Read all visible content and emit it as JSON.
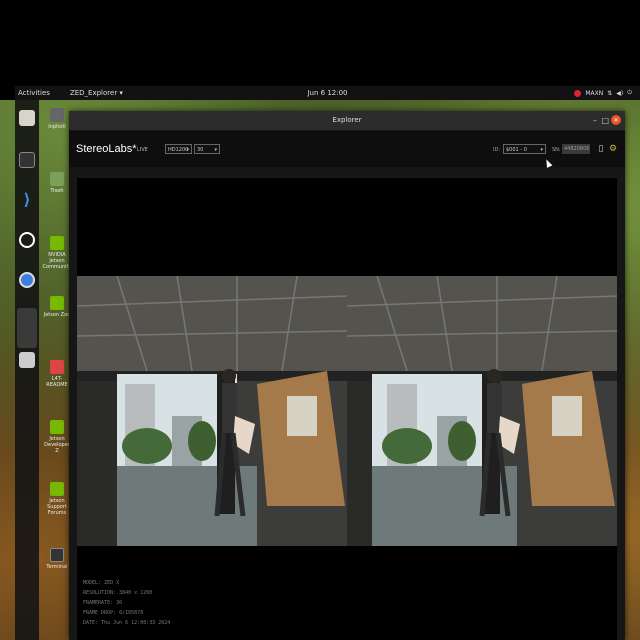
{
  "topbar": {
    "activities": "Activities",
    "app_menu": "ZED_Explorer ▾",
    "clock": "Jun 6 12:00",
    "tray_label": "MAXN"
  },
  "desktop": {
    "icons": [
      "Inphoti",
      "Trash",
      "NVIDIA Jetson Community",
      "Jetson Zoo",
      "L4T-README",
      "Jetson Developer Z",
      "Jetson Support Forums",
      "Terminal"
    ]
  },
  "window": {
    "title": "Explorer",
    "minimize": "–",
    "maximize": "□",
    "close": "×"
  },
  "toolbar": {
    "brand": "StereoLabs*",
    "live_label": "LIVE",
    "resolution": "HD1200",
    "fps": "30",
    "id_label": "ID:",
    "id_value": "$001 - 0",
    "sn_label": "SN:",
    "sn_value": "44820806"
  },
  "info": {
    "model": "MODEL: ZED X",
    "resolution": "RESOLUTION: 3840 x 1200",
    "framerate": "FRAMERATE: 30",
    "frame_drop": "FRAME DROP: 0/105878",
    "date": "DATE: Thu Jun 6 12:00:33 2024"
  },
  "colors": {
    "accent": "#e95420",
    "window_bg": "#161616",
    "toolbar_bg": "#0e0e0e"
  }
}
